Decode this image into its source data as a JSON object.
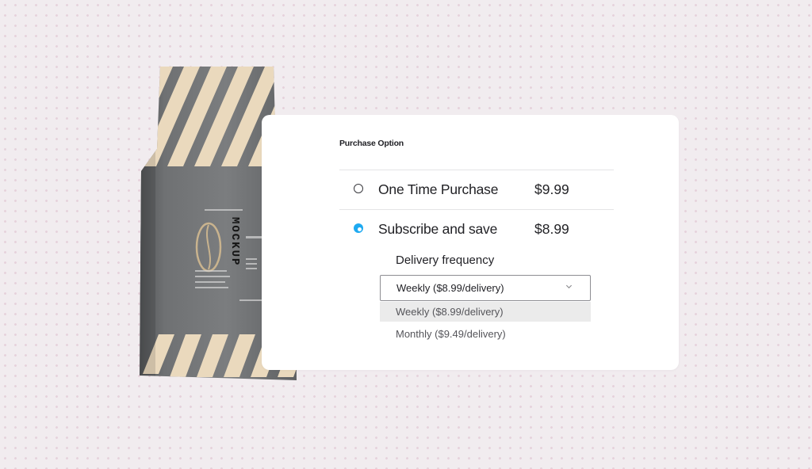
{
  "purchase": {
    "section_title": "Purchase Option",
    "options": [
      {
        "label": "One Time Purchase",
        "price": "$9.99",
        "selected": false
      },
      {
        "label": "Subscribe and save",
        "price": "$8.99",
        "selected": true
      }
    ],
    "delivery": {
      "label": "Delivery frequency",
      "selected_value": "Weekly ($8.99/delivery)",
      "options": [
        "Weekly ($8.99/delivery)",
        "Monthly ($9.49/delivery)"
      ],
      "highlighted_index": 0
    }
  },
  "product": {
    "brand_text": "MOCKUP",
    "image": "coffee-bag-image"
  },
  "colors": {
    "accent": "#1eaaf1",
    "bag": "#727476",
    "stripe": "#ead9bd",
    "background": "#f1ecef"
  }
}
